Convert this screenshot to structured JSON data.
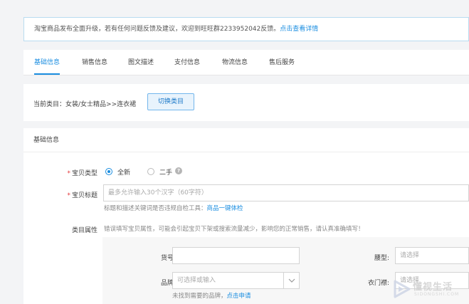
{
  "notice": {
    "text": "淘宝商品发布全面升级，若有任何问题反馈及建议，欢迎到旺旺群2233952042反馈。",
    "link": "点击查看详情"
  },
  "tabs": [
    {
      "label": "基础信息",
      "active": true
    },
    {
      "label": "销售信息",
      "active": false
    },
    {
      "label": "图文描述",
      "active": false
    },
    {
      "label": "支付信息",
      "active": false
    },
    {
      "label": "物流信息",
      "active": false
    },
    {
      "label": "售后服务",
      "active": false
    }
  ],
  "category": {
    "label": "当前类目：女装/女士精品>>连衣裙",
    "switch_button": "切换类目"
  },
  "section": {
    "title": "基础信息",
    "item_type": {
      "label": "宝贝类型",
      "options": [
        {
          "label": "全新",
          "selected": true
        },
        {
          "label": "二手",
          "selected": false
        }
      ]
    },
    "item_title": {
      "label": "宝贝标题",
      "placeholder": "最多允许输入30个汉字（60字符）",
      "hint": "标题和描述关键词是否违规自检工具：",
      "hint_link": "商品一键体检"
    },
    "attributes": {
      "label": "类目属性",
      "warning": "错误填写宝贝属性，可能会引起宝贝下架或搜索流量减少，影响您的正常销售，请认真准确填写！",
      "fields": {
        "item_no_label": "货号:",
        "waist_label": "腰型:",
        "waist_placeholder": "请选择",
        "brand_label": "品牌:",
        "brand_placeholder": "可选择或输入",
        "brand_hint": "未找到需要的品牌，",
        "brand_hint_link": "点击申请",
        "placket_label": "衣门襟:",
        "placket_placeholder": "请选择"
      }
    }
  },
  "watermark": {
    "text": "懂视生活",
    "sub": "SIDONGSHI.COM"
  },
  "colors": {
    "accent": "#1a8de0",
    "required": "#e4393c"
  }
}
